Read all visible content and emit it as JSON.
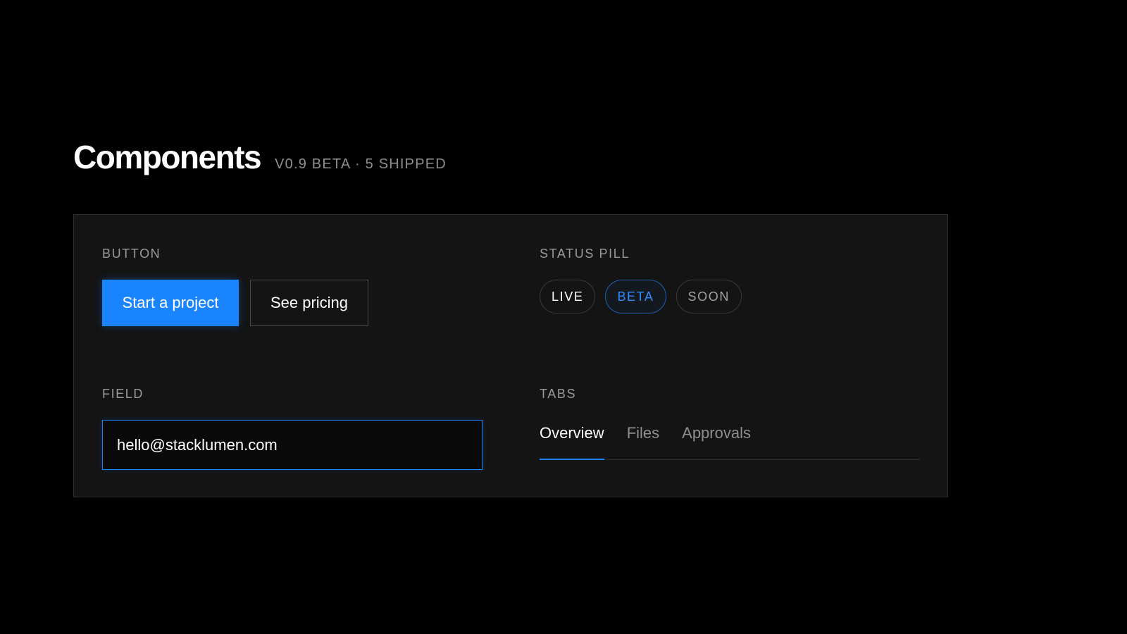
{
  "header": {
    "title": "Components",
    "meta": "V0.9 BETA · 5 SHIPPED"
  },
  "sections": {
    "button": {
      "label": "BUTTON",
      "primary_label": "Start a project",
      "secondary_label": "See pricing"
    },
    "status_pill": {
      "label": "STATUS PILL",
      "pills": [
        "LIVE",
        "BETA",
        "SOON"
      ]
    },
    "field": {
      "label": "FIELD",
      "value": "hello@stacklumen.com"
    },
    "tabs": {
      "label": "TABS",
      "items": [
        "Overview",
        "Files",
        "Approvals"
      ],
      "active": "Overview"
    }
  },
  "colors": {
    "background": "#000000",
    "panel": "#141414",
    "accent": "#1a84ff"
  }
}
